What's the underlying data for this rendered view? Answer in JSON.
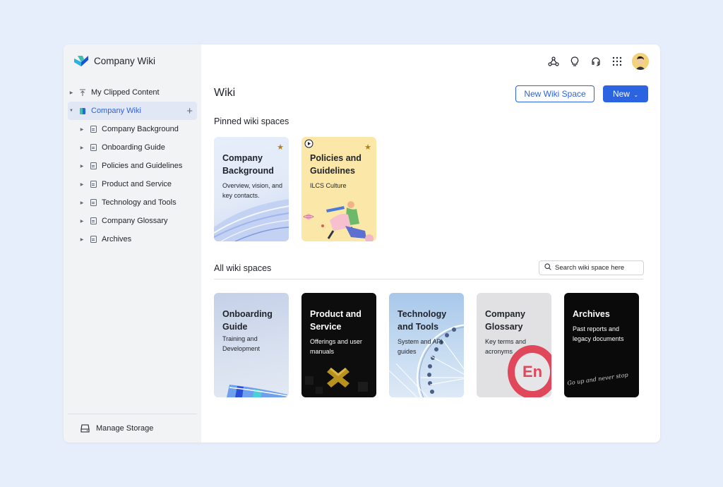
{
  "app": {
    "title": "Company Wiki"
  },
  "sidebar": {
    "clipped": "My Clipped Content",
    "root": "Company Wiki",
    "items": [
      "Company Background",
      "Onboarding Guide",
      "Policies and Guidelines",
      "Product and Service",
      "Technology and Tools",
      "Company Glossary",
      "Archives"
    ],
    "footer": "Manage Storage"
  },
  "header": {
    "title": "Wiki",
    "new_space_label": "New Wiki Space",
    "new_label": "New",
    "icons": [
      "network-icon",
      "lightbulb-icon",
      "headset-icon",
      "apps-grid-icon",
      "user-avatar"
    ]
  },
  "pinned": {
    "title": "Pinned wiki spaces",
    "cards": [
      {
        "title": "Company Background",
        "desc": "Overview, vision, and key contacts.",
        "starred": true
      },
      {
        "title": "Policies and Guidelines",
        "desc": "ILCS Culture",
        "starred": true
      }
    ]
  },
  "all": {
    "title": "All wiki spaces",
    "search_placeholder": "Search wiki space here",
    "cards": [
      {
        "title": "Onboarding Guide",
        "desc": "Training and Development"
      },
      {
        "title": "Product and Service",
        "desc": "Offerings and user manuals"
      },
      {
        "title": "Technology and Tools",
        "desc": "System and API guides"
      },
      {
        "title": "Company Glossary",
        "desc": "Key terms and acronyms",
        "badge": "En"
      },
      {
        "title": "Archives",
        "desc": "Past reports and legacy documents",
        "tagline": "Go up and never stop"
      }
    ]
  },
  "colors": {
    "accent": "#2b63e0",
    "sidebar_bg": "#f2f3f5",
    "page_bg": "#e6edfb",
    "star": "#b3801e"
  }
}
